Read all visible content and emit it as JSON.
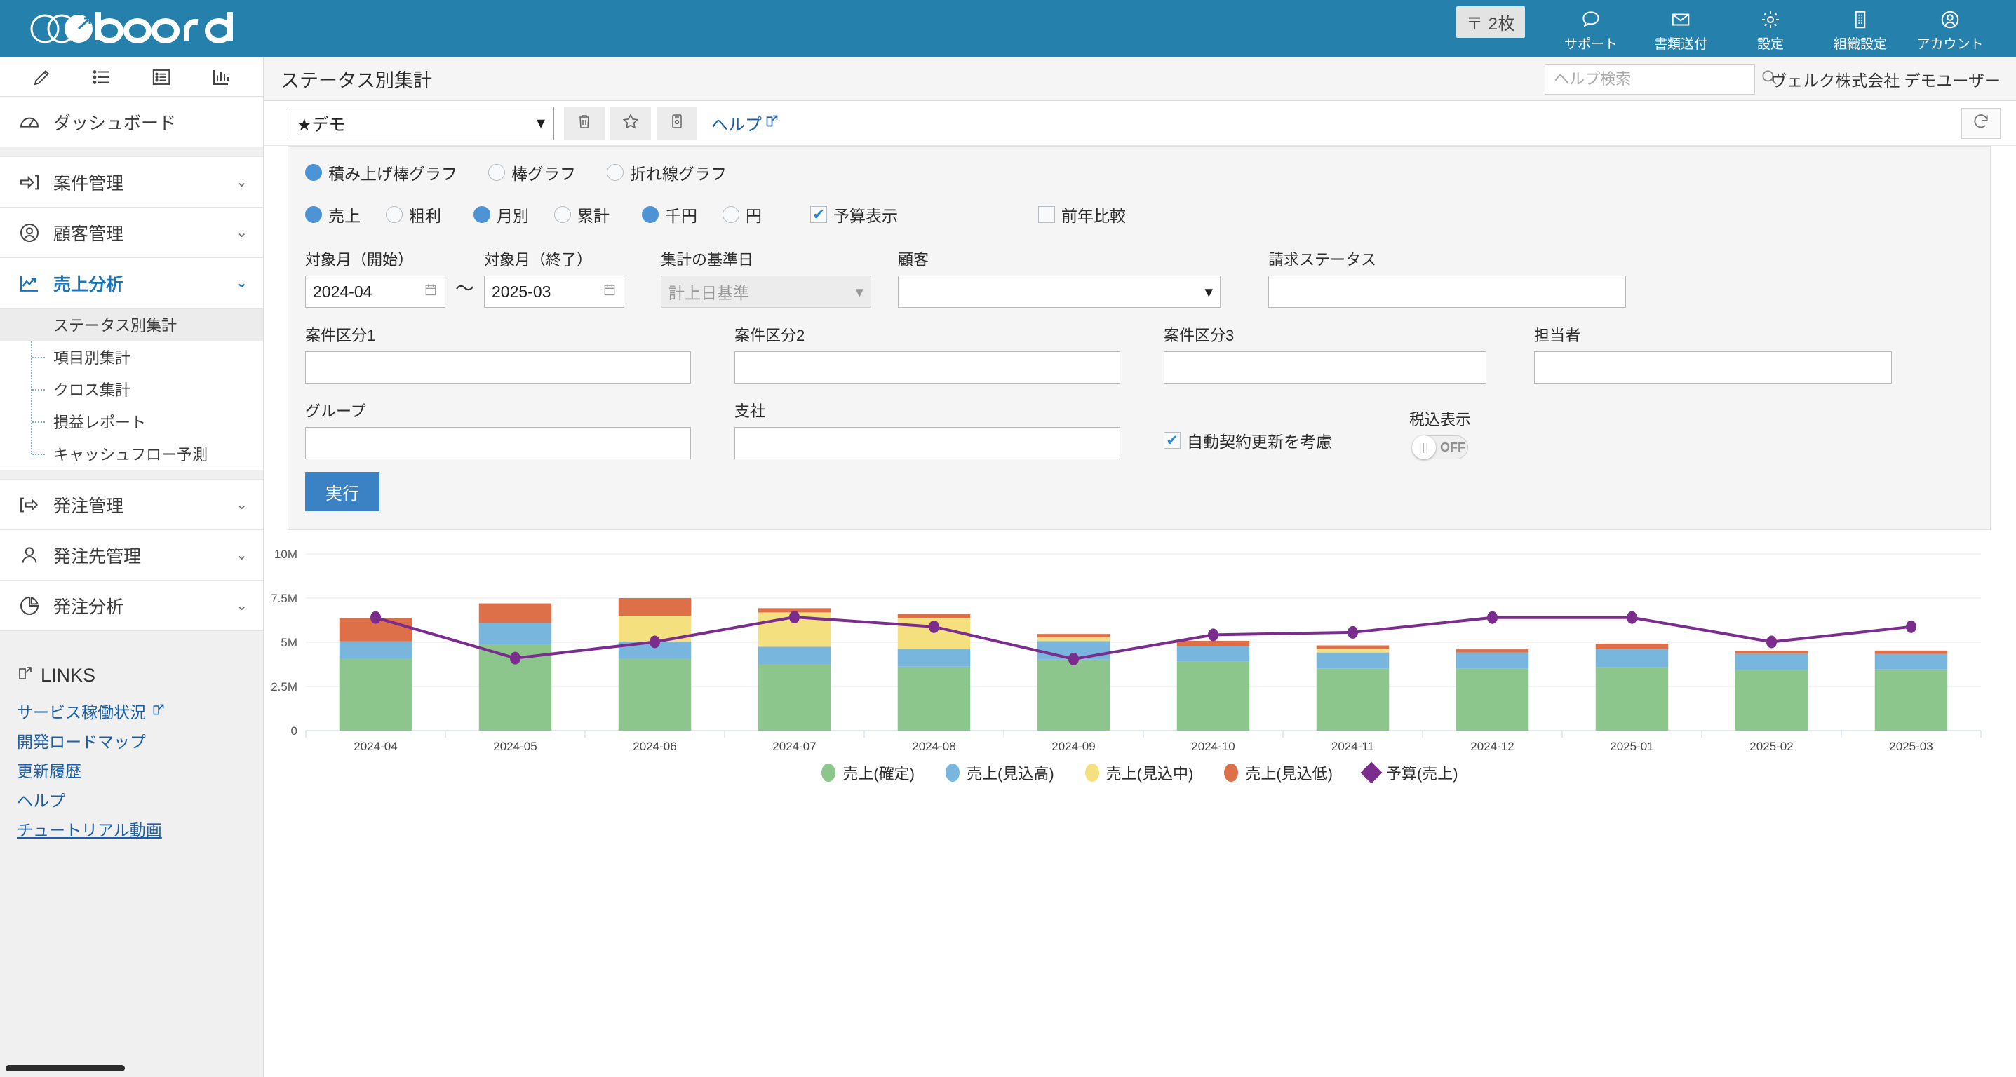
{
  "brand": {
    "logo_text": "board",
    "bar_color": "#2580ab"
  },
  "topbar": {
    "mail_badge": "〒 2枚",
    "items": [
      {
        "icon": "chat-icon",
        "label": "サポート"
      },
      {
        "icon": "mail-icon",
        "label": "書類送付"
      },
      {
        "icon": "gear-icon",
        "label": "設定"
      },
      {
        "icon": "building-icon",
        "label": "組織設定"
      },
      {
        "icon": "account-icon",
        "label": "アカウント"
      }
    ]
  },
  "sidebar": {
    "tool_icons": [
      "pencil-icon",
      "list-icon",
      "list-box-icon",
      "bar-chart-icon"
    ],
    "dashboard": {
      "icon": "gauge-icon",
      "label": "ダッシュボード"
    },
    "nav": [
      {
        "icon": "case-icon",
        "label": "案件管理",
        "chevron": "⌄"
      },
      {
        "icon": "customer-icon",
        "label": "顧客管理",
        "chevron": "⌄"
      },
      {
        "icon": "sales-analysis-icon",
        "label": "売上分析",
        "chevron": "⌄",
        "active": true
      }
    ],
    "subnav": [
      {
        "label": "ステータス別集計",
        "selected": true
      },
      {
        "label": "項目別集計",
        "selected": false
      },
      {
        "label": "クロス集計",
        "selected": false
      },
      {
        "label": "損益レポート",
        "selected": false
      },
      {
        "label": "キャッシュフロー予測",
        "selected": false
      }
    ],
    "nav2": [
      {
        "icon": "order-icon",
        "label": "発注管理",
        "chevron": "⌄"
      },
      {
        "icon": "supplier-icon",
        "label": "発注先管理",
        "chevron": "⌄"
      },
      {
        "icon": "order-analysis-icon",
        "label": "発注分析",
        "chevron": "⌄"
      }
    ],
    "links_title": "LINKS",
    "links": [
      {
        "label": "サービス稼働状況",
        "external": true,
        "underlined": false
      },
      {
        "label": "開発ロードマップ",
        "external": false,
        "underlined": false
      },
      {
        "label": "更新履歴",
        "external": false,
        "underlined": false
      },
      {
        "label": "ヘルプ",
        "external": false,
        "underlined": false
      },
      {
        "label": "チュートリアル動画",
        "external": false,
        "underlined": true
      }
    ]
  },
  "page": {
    "title": "ステータス別集計",
    "help_search_placeholder": "ヘルプ検索",
    "help_search_value": "",
    "user_name": "ヴェルク株式会社 デモユーザー"
  },
  "toolbar": {
    "preset_value": "★デモ",
    "buttons": [
      "trash-icon",
      "star-icon",
      "save-icon"
    ],
    "help_link": "ヘルプ",
    "refresh": "refresh-icon"
  },
  "filters": {
    "chart_type": {
      "options": [
        "積み上げ棒グラフ",
        "棒グラフ",
        "折れ線グラフ"
      ],
      "selected": "積み上げ棒グラフ"
    },
    "metric": {
      "options": [
        "売上",
        "粗利"
      ],
      "selected": "売上"
    },
    "aggregation": {
      "options": [
        "月別",
        "累計"
      ],
      "selected": "月別"
    },
    "unit": {
      "options": [
        "千円",
        "円"
      ],
      "selected": "千円"
    },
    "budget_display": {
      "label": "予算表示",
      "checked": true
    },
    "yoy_compare": {
      "label": "前年比較",
      "checked": false
    },
    "month_start": {
      "label": "対象月（開始）",
      "value": "2024-04",
      "icon": "calendar-icon"
    },
    "range_separator": "〜",
    "month_end": {
      "label": "対象月（終了）",
      "value": "2025-03",
      "icon": "calendar-icon"
    },
    "basis_date": {
      "label": "集計の基準日",
      "value": "計上日基準",
      "disabled": true
    },
    "customer": {
      "label": "顧客",
      "value": ""
    },
    "billing_status": {
      "label": "請求ステータス",
      "value": ""
    },
    "case_class1": {
      "label": "案件区分1",
      "value": ""
    },
    "case_class2": {
      "label": "案件区分2",
      "value": ""
    },
    "case_class3": {
      "label": "案件区分3",
      "value": ""
    },
    "owner": {
      "label": "担当者",
      "value": ""
    },
    "group": {
      "label": "グループ",
      "value": ""
    },
    "branch": {
      "label": "支社",
      "value": ""
    },
    "auto_renew": {
      "label": "自動契約更新を考慮",
      "checked": true
    },
    "tax_display": {
      "label": "税込表示",
      "state": "OFF"
    },
    "execute_button": "実行"
  },
  "chart_data": {
    "type": "bar",
    "title": "",
    "xlabel": "",
    "ylabel": "",
    "stacked": true,
    "grid": true,
    "legend_position": "bottom",
    "ylim": [
      0,
      10000000
    ],
    "ytick_labels": [
      "10M",
      "7.5M",
      "5M",
      "2.5M",
      "0"
    ],
    "ytick_values": [
      10000000,
      7500000,
      5000000,
      2500000,
      0
    ],
    "categories": [
      "2024-04",
      "2024-05",
      "2024-06",
      "2024-07",
      "2024-08",
      "2024-09",
      "2024-10",
      "2024-11",
      "2024-12",
      "2025-01",
      "2025-02",
      "2025-03"
    ],
    "series": [
      {
        "name": "売上(確定)",
        "color": "#8cc68c",
        "values": [
          4050000,
          4880000,
          4050000,
          3750000,
          3620000,
          4020000,
          3900000,
          3520000,
          3500000,
          3580000,
          3450000,
          3460000
        ]
      },
      {
        "name": "売上(見込高)",
        "color": "#79b6dd",
        "values": [
          1000000,
          1220000,
          1000000,
          1000000,
          1020000,
          1040000,
          880000,
          900000,
          920000,
          1020000,
          900000,
          880000
        ]
      },
      {
        "name": "売上(見込中)",
        "color": "#f4e07f",
        "values": [
          0,
          0,
          1450000,
          1940000,
          1720000,
          220000,
          0,
          200000,
          0,
          0,
          0,
          0
        ]
      },
      {
        "name": "売上(見込低)",
        "color": "#de7049",
        "values": [
          1320000,
          1100000,
          1000000,
          240000,
          230000,
          190000,
          300000,
          200000,
          180000,
          320000,
          170000,
          190000
        ]
      }
    ],
    "budget_series": {
      "name": "予算(売上)",
      "color": "#7b2d8e",
      "type": "line",
      "values": [
        6400000,
        4100000,
        5020000,
        6430000,
        5880000,
        4050000,
        5420000,
        5560000,
        6400000,
        6400000,
        5020000,
        5880000
      ]
    }
  }
}
